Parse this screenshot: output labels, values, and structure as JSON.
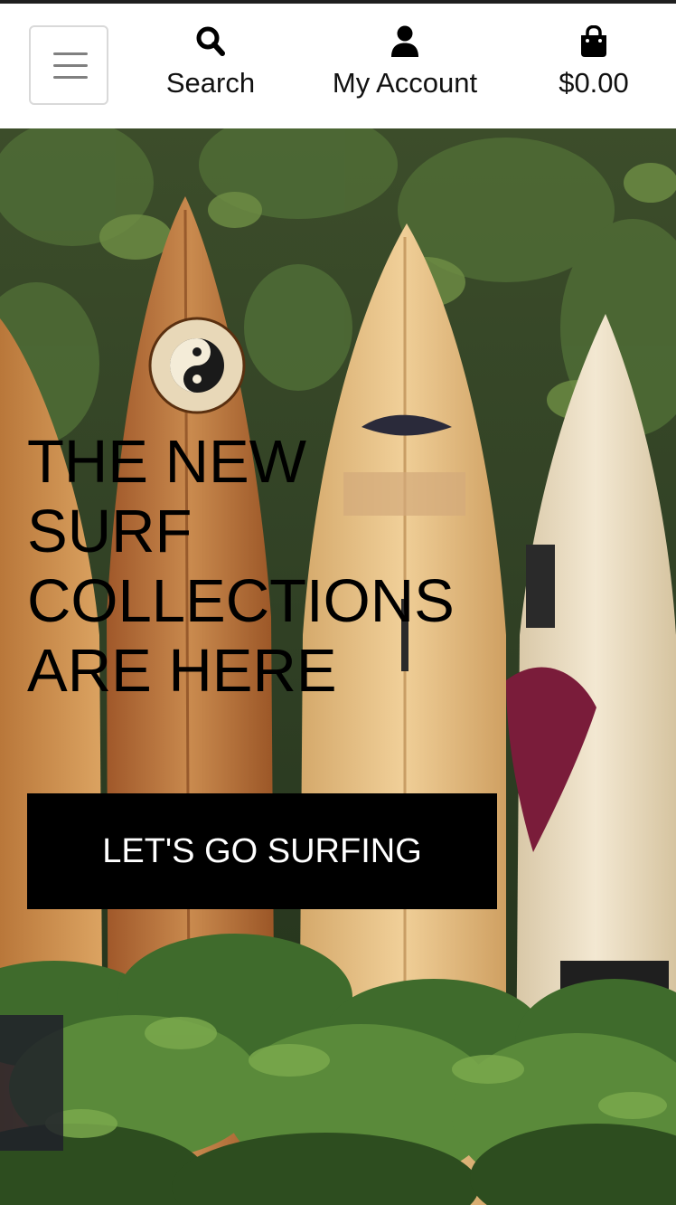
{
  "header": {
    "menu_icon": "hamburger-icon",
    "nav": [
      {
        "icon": "search-icon",
        "label": "Search"
      },
      {
        "icon": "user-icon",
        "label": "My Account"
      },
      {
        "icon": "shopping-bag-icon",
        "label": "$0.00"
      }
    ]
  },
  "hero": {
    "title_lines": [
      "THE NEW",
      "SURF",
      "COLLECTIONS",
      "ARE HERE"
    ],
    "cta_label": "LET'S GO SURFING"
  }
}
